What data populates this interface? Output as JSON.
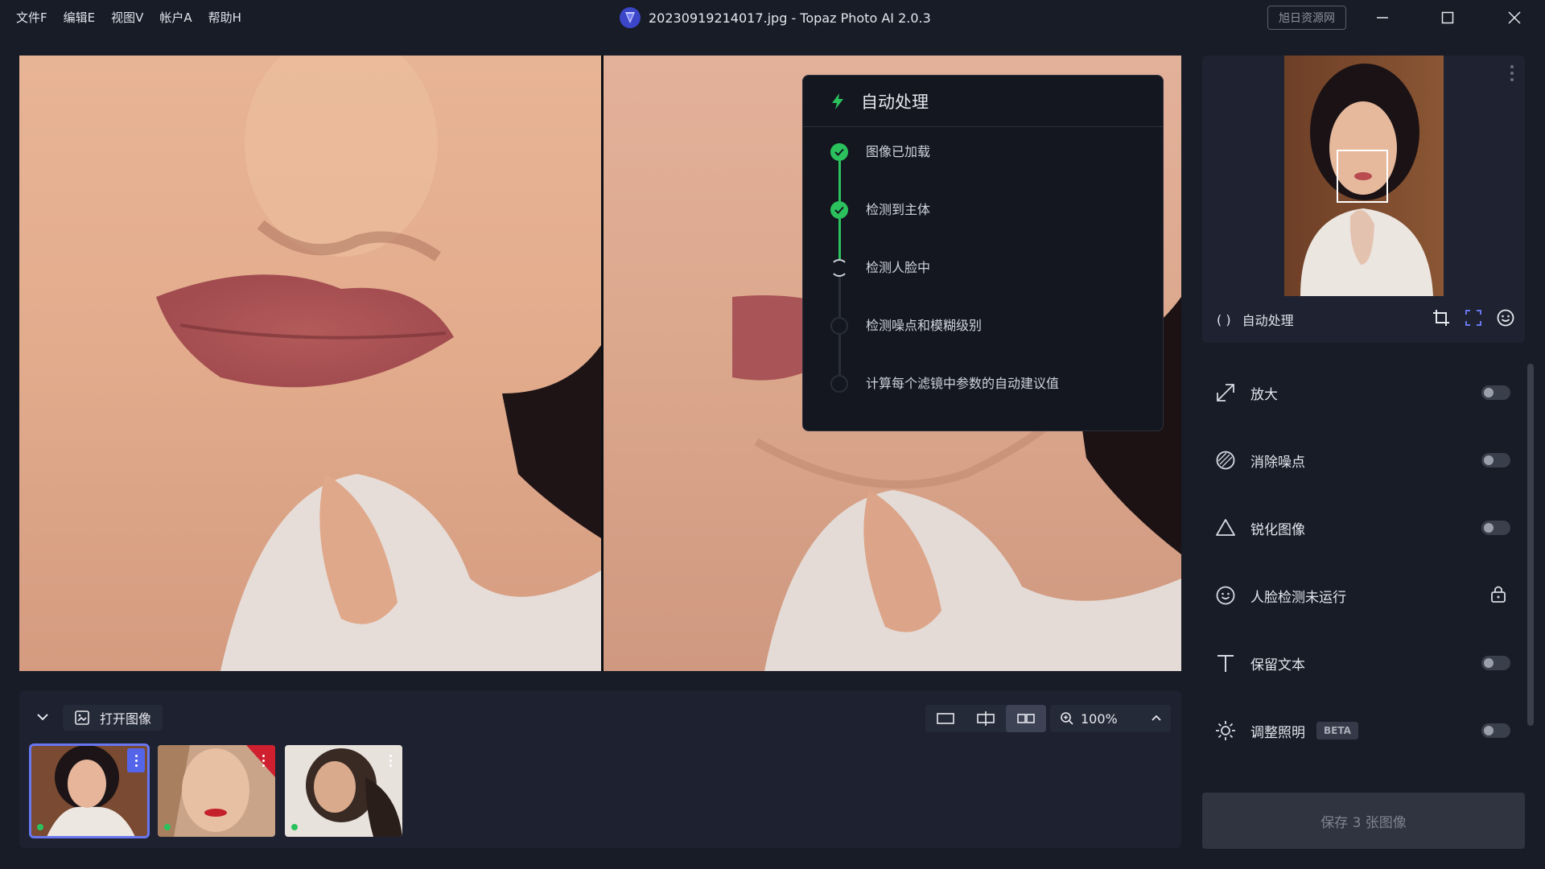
{
  "menu": [
    "文件F",
    "编辑E",
    "视图V",
    "帐户A",
    "帮助H"
  ],
  "window": {
    "title": "20230919214017.jpg - Topaz Photo AI 2.0.3",
    "watermark": "旭日资源网"
  },
  "auto_panel": {
    "title": "自动处理",
    "steps": [
      {
        "label": "图像已加载",
        "state": "done"
      },
      {
        "label": "检测到主体",
        "state": "done"
      },
      {
        "label": "检测人脸中",
        "state": "loading"
      },
      {
        "label": "检测噪点和模糊级别",
        "state": "pending"
      },
      {
        "label": "计算每个滤镜中参数的自动建议值",
        "state": "pending"
      }
    ]
  },
  "bottom_bar": {
    "open_image": "打开图像",
    "zoom": "100%"
  },
  "navigator": {
    "mode_icon": "( )",
    "mode_label": "自动处理"
  },
  "filters": [
    {
      "label": "放大",
      "icon": "expand-arrow-icon",
      "control": "toggle"
    },
    {
      "label": "消除噪点",
      "icon": "denoise-icon",
      "control": "toggle"
    },
    {
      "label": "锐化图像",
      "icon": "triangle-icon",
      "control": "toggle"
    },
    {
      "label": "人脸检测未运行",
      "icon": "smiley-face-icon",
      "control": "lock"
    },
    {
      "label": "保留文本",
      "icon": "text-t-icon",
      "control": "toggle"
    },
    {
      "label": "调整照明",
      "icon": "sun-icon",
      "control": "toggle",
      "badge": "BETA"
    }
  ],
  "save_button": "保存 3 张图像",
  "colors": {
    "background": "#181c27",
    "accent": "#5565ea",
    "success": "#2bc25e"
  }
}
